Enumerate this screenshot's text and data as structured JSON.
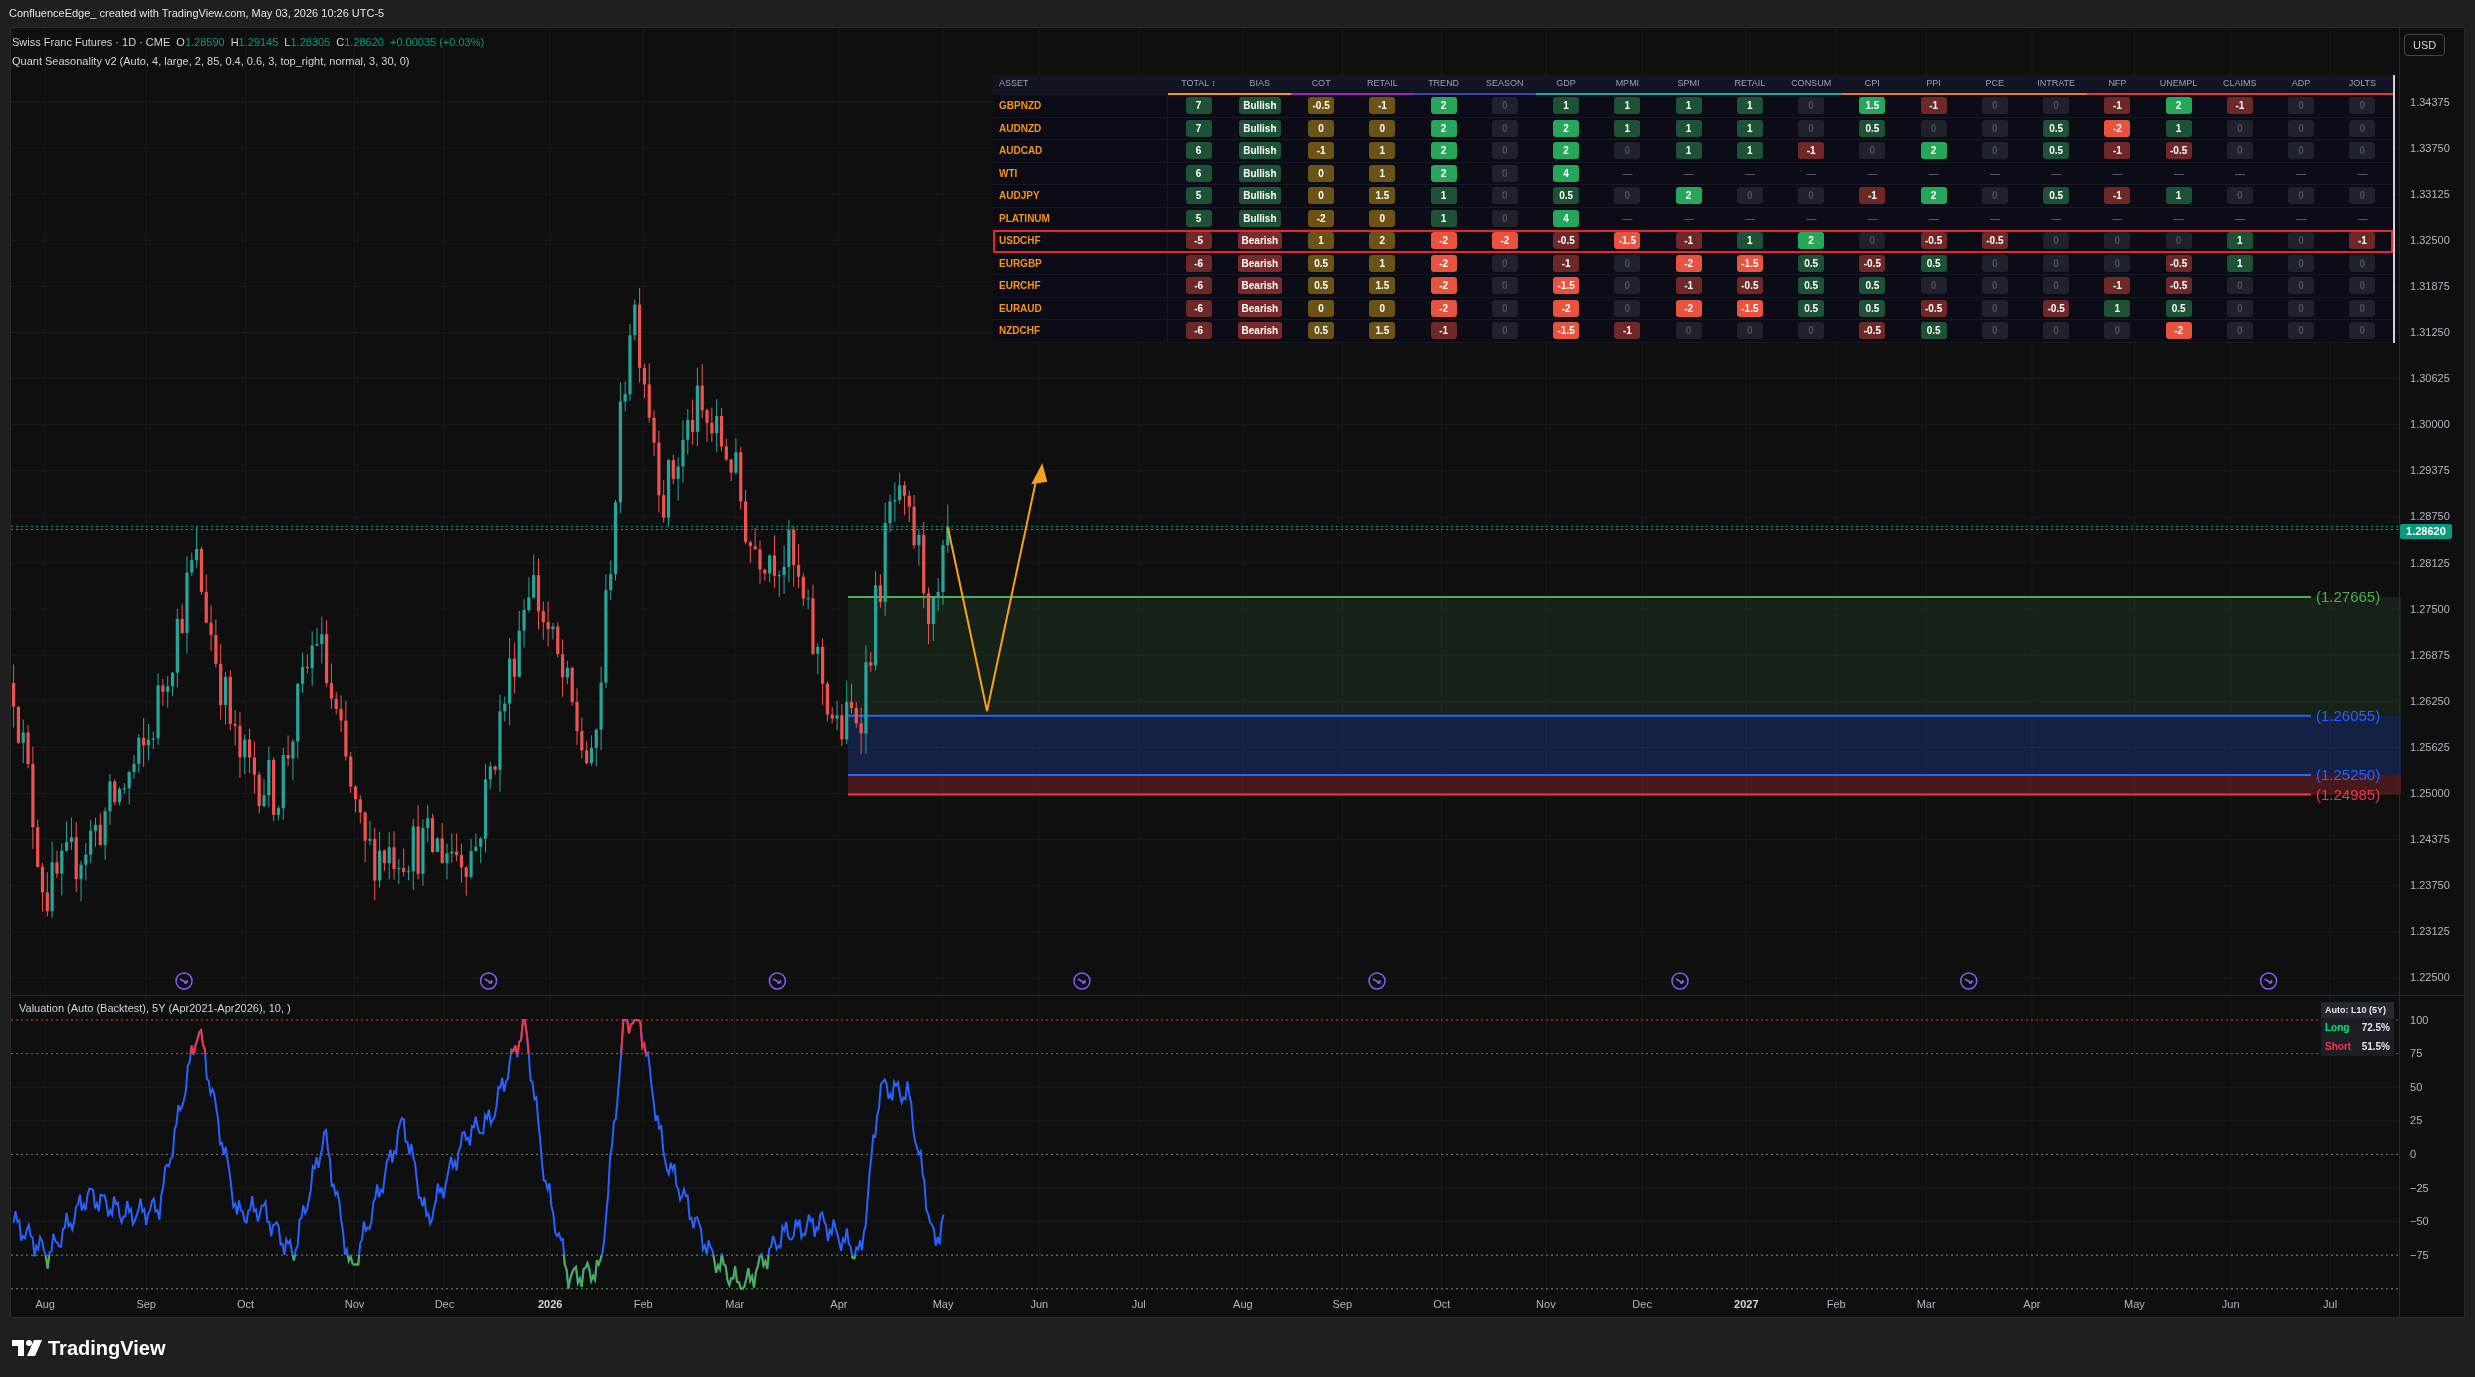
{
  "page_title": "ConfluenceEdge_ created with TradingView.com, May 03, 2026 10:26 UTC-5",
  "legend": {
    "symbol": "Swiss Franc Futures · 1D · CME",
    "ohlc": [
      {
        "label": "O",
        "value": "1.28590"
      },
      {
        "label": "H",
        "value": "1.29145"
      },
      {
        "label": "L",
        "value": "1.28305"
      },
      {
        "label": "C",
        "value": "1.28620"
      }
    ],
    "change": "+0.00035 (+0.03%)",
    "indicator": "Quant Seasonality v2 (Auto, 4, large, 2, 85, 0.4, 0.6, 3, top_right, normal, 3, 30, 0)"
  },
  "currency_button": "USD",
  "table": {
    "columns": [
      {
        "label": "ASSET"
      },
      {
        "label": "TOTAL ↕",
        "color": "#f59e0b"
      },
      {
        "label": "BIAS",
        "color": "#f59e0b"
      },
      {
        "label": "COT",
        "color": "#9c27b0"
      },
      {
        "label": "RETAIL",
        "color": "#9c27b0"
      },
      {
        "label": "TREND",
        "color": "#3949ab"
      },
      {
        "label": "SEASON",
        "color": "#3949ab"
      },
      {
        "label": "GDP",
        "color": "#26a69a"
      },
      {
        "label": "MPMI",
        "color": "#26a69a"
      },
      {
        "label": "SPMI",
        "color": "#26a69a"
      },
      {
        "label": "RETAIL",
        "color": "#26a69a"
      },
      {
        "label": "CONSUM",
        "color": "#26a69a"
      },
      {
        "label": "CPI",
        "color": "#e67e22"
      },
      {
        "label": "PPI",
        "color": "#e67e22"
      },
      {
        "label": "PCE",
        "color": "#e67e22"
      },
      {
        "label": "INTRATE",
        "color": "#e67e22"
      },
      {
        "label": "NFP",
        "color": "#e53935"
      },
      {
        "label": "UNEMPL",
        "color": "#e53935"
      },
      {
        "label": "CLAIMS",
        "color": "#e53935"
      },
      {
        "label": "ADP",
        "color": "#e53935"
      },
      {
        "label": "JOLTS",
        "color": "#e53935"
      }
    ],
    "rows": [
      {
        "selected": false,
        "cells": [
          {
            "text": "GBPNZD"
          },
          {
            "text": "7",
            "color": "#1d5236"
          },
          {
            "text": "Bullish",
            "color": "#1d5236"
          },
          {
            "text": "-0.5",
            "color": "#6b5316"
          },
          {
            "text": "-1",
            "color": "#6b5316"
          },
          {
            "text": "2",
            "color": "#26a65b"
          },
          {
            "text": "0",
            "color": "#1f212b"
          },
          {
            "text": "1",
            "color": "#1d5236"
          },
          {
            "text": "1",
            "color": "#1d5236"
          },
          {
            "text": "1",
            "color": "#1d5236"
          },
          {
            "text": "1",
            "color": "#1d5236"
          },
          {
            "text": "0",
            "color": "#1f212b"
          },
          {
            "text": "1.5",
            "color": "#26a65b"
          },
          {
            "text": "-1",
            "color": "#6e2828"
          },
          {
            "text": "0",
            "color": "#1f212b"
          },
          {
            "text": "0",
            "color": "#1f212b"
          },
          {
            "text": "-1",
            "color": "#6e2828"
          },
          {
            "text": "2",
            "color": "#26a65b"
          },
          {
            "text": "-1",
            "color": "#6e2828"
          },
          {
            "text": "0",
            "color": "#1f212b"
          },
          {
            "text": "0",
            "color": "#1f212b"
          }
        ]
      },
      {
        "selected": false,
        "cells": [
          {
            "text": "AUDNZD"
          },
          {
            "text": "7",
            "color": "#1d5236"
          },
          {
            "text": "Bullish",
            "color": "#1d5236"
          },
          {
            "text": "0",
            "color": "#6b5316"
          },
          {
            "text": "0",
            "color": "#6b5316"
          },
          {
            "text": "2",
            "color": "#26a65b"
          },
          {
            "text": "0",
            "color": "#1f212b"
          },
          {
            "text": "2",
            "color": "#26a65b"
          },
          {
            "text": "1",
            "color": "#1d5236"
          },
          {
            "text": "1",
            "color": "#1d5236"
          },
          {
            "text": "1",
            "color": "#1d5236"
          },
          {
            "text": "0",
            "color": "#1f212b"
          },
          {
            "text": "0.5",
            "color": "#1d5236"
          },
          {
            "text": "0",
            "color": "#1f212b"
          },
          {
            "text": "0",
            "color": "#1f212b"
          },
          {
            "text": "0.5",
            "color": "#1d5236"
          },
          {
            "text": "-2",
            "color": "#e8533f"
          },
          {
            "text": "1",
            "color": "#1d5236"
          },
          {
            "text": "0",
            "color": "#1f212b"
          },
          {
            "text": "0",
            "color": "#1f212b"
          },
          {
            "text": "0",
            "color": "#1f212b"
          }
        ]
      },
      {
        "selected": false,
        "cells": [
          {
            "text": "AUDCAD"
          },
          {
            "text": "6",
            "color": "#1d5236"
          },
          {
            "text": "Bullish",
            "color": "#1d5236"
          },
          {
            "text": "-1",
            "color": "#6b5316"
          },
          {
            "text": "1",
            "color": "#6b5316"
          },
          {
            "text": "2",
            "color": "#26a65b"
          },
          {
            "text": "0",
            "color": "#1f212b"
          },
          {
            "text": "2",
            "color": "#26a65b"
          },
          {
            "text": "0",
            "color": "#1f212b"
          },
          {
            "text": "1",
            "color": "#1d5236"
          },
          {
            "text": "1",
            "color": "#1d5236"
          },
          {
            "text": "-1",
            "color": "#6e2828"
          },
          {
            "text": "0",
            "color": "#1f212b"
          },
          {
            "text": "2",
            "color": "#26a65b"
          },
          {
            "text": "0",
            "color": "#1f212b"
          },
          {
            "text": "0.5",
            "color": "#1d5236"
          },
          {
            "text": "-1",
            "color": "#6e2828"
          },
          {
            "text": "-0.5",
            "color": "#6e2828"
          },
          {
            "text": "0",
            "color": "#1f212b"
          },
          {
            "text": "0",
            "color": "#1f212b"
          },
          {
            "text": "0",
            "color": "#1f212b"
          }
        ]
      },
      {
        "selected": false,
        "cells": [
          {
            "text": "WTI"
          },
          {
            "text": "6",
            "color": "#1d5236"
          },
          {
            "text": "Bullish",
            "color": "#1d5236"
          },
          {
            "text": "0",
            "color": "#6b5316"
          },
          {
            "text": "1",
            "color": "#6b5316"
          },
          {
            "text": "2",
            "color": "#26a65b"
          },
          {
            "text": "0",
            "color": "#1f212b"
          },
          {
            "text": "4",
            "color": "#26a65b"
          },
          {
            "text": "—"
          },
          {
            "text": "—"
          },
          {
            "text": "—"
          },
          {
            "text": "—"
          },
          {
            "text": "—"
          },
          {
            "text": "—"
          },
          {
            "text": "—"
          },
          {
            "text": "—"
          },
          {
            "text": "—"
          },
          {
            "text": "—"
          },
          {
            "text": "—"
          },
          {
            "text": "—"
          },
          {
            "text": "—"
          }
        ]
      },
      {
        "selected": false,
        "cells": [
          {
            "text": "AUDJPY"
          },
          {
            "text": "5",
            "color": "#1d5236"
          },
          {
            "text": "Bullish",
            "color": "#1d5236"
          },
          {
            "text": "0",
            "color": "#6b5316"
          },
          {
            "text": "1.5",
            "color": "#6b5316"
          },
          {
            "text": "1",
            "color": "#1d5236"
          },
          {
            "text": "0",
            "color": "#1f212b"
          },
          {
            "text": "0.5",
            "color": "#1d5236"
          },
          {
            "text": "0",
            "color": "#1f212b"
          },
          {
            "text": "2",
            "color": "#26a65b"
          },
          {
            "text": "0",
            "color": "#1f212b"
          },
          {
            "text": "0",
            "color": "#1f212b"
          },
          {
            "text": "-1",
            "color": "#6e2828"
          },
          {
            "text": "2",
            "color": "#26a65b"
          },
          {
            "text": "0",
            "color": "#1f212b"
          },
          {
            "text": "0.5",
            "color": "#1d5236"
          },
          {
            "text": "-1",
            "color": "#6e2828"
          },
          {
            "text": "1",
            "color": "#1d5236"
          },
          {
            "text": "0",
            "color": "#1f212b"
          },
          {
            "text": "0",
            "color": "#1f212b"
          },
          {
            "text": "0",
            "color": "#1f212b"
          }
        ]
      },
      {
        "selected": false,
        "cells": [
          {
            "text": "PLATINUM"
          },
          {
            "text": "5",
            "color": "#1d5236"
          },
          {
            "text": "Bullish",
            "color": "#1d5236"
          },
          {
            "text": "-2",
            "color": "#6b5316"
          },
          {
            "text": "0",
            "color": "#6b5316"
          },
          {
            "text": "1",
            "color": "#1d5236"
          },
          {
            "text": "0",
            "color": "#1f212b"
          },
          {
            "text": "4",
            "color": "#26a65b"
          },
          {
            "text": "—"
          },
          {
            "text": "—"
          },
          {
            "text": "—"
          },
          {
            "text": "—"
          },
          {
            "text": "—"
          },
          {
            "text": "—"
          },
          {
            "text": "—"
          },
          {
            "text": "—"
          },
          {
            "text": "—"
          },
          {
            "text": "—"
          },
          {
            "text": "—"
          },
          {
            "text": "—"
          },
          {
            "text": "—"
          }
        ]
      },
      {
        "selected": true,
        "cells": [
          {
            "text": "USDCHF"
          },
          {
            "text": "-5",
            "color": "#6e2828"
          },
          {
            "text": "Bearish",
            "color": "#7a2a2a"
          },
          {
            "text": "1",
            "color": "#6b5316"
          },
          {
            "text": "2",
            "color": "#6b5316"
          },
          {
            "text": "-2",
            "color": "#e8533f"
          },
          {
            "text": "-2",
            "color": "#e8533f"
          },
          {
            "text": "-0.5",
            "color": "#6e2828"
          },
          {
            "text": "-1.5",
            "color": "#e8533f"
          },
          {
            "text": "-1",
            "color": "#6e2828"
          },
          {
            "text": "1",
            "color": "#1d5236"
          },
          {
            "text": "2",
            "color": "#26a65b"
          },
          {
            "text": "0",
            "color": "#1f212b"
          },
          {
            "text": "-0.5",
            "color": "#6e2828"
          },
          {
            "text": "-0.5",
            "color": "#6e2828"
          },
          {
            "text": "0",
            "color": "#1f212b"
          },
          {
            "text": "0",
            "color": "#1f212b"
          },
          {
            "text": "0",
            "color": "#1f212b"
          },
          {
            "text": "1",
            "color": "#1d5236"
          },
          {
            "text": "0",
            "color": "#1f212b"
          },
          {
            "text": "-1",
            "color": "#6e2828"
          }
        ]
      },
      {
        "selected": false,
        "cells": [
          {
            "text": "EURGBP"
          },
          {
            "text": "-6",
            "color": "#6e2828"
          },
          {
            "text": "Bearish",
            "color": "#7a2a2a"
          },
          {
            "text": "0.5",
            "color": "#6b5316"
          },
          {
            "text": "1",
            "color": "#6b5316"
          },
          {
            "text": "-2",
            "color": "#e8533f"
          },
          {
            "text": "0",
            "color": "#1f212b"
          },
          {
            "text": "-1",
            "color": "#6e2828"
          },
          {
            "text": "0",
            "color": "#1f212b"
          },
          {
            "text": "-2",
            "color": "#e8533f"
          },
          {
            "text": "-1.5",
            "color": "#e8533f"
          },
          {
            "text": "0.5",
            "color": "#1d5236"
          },
          {
            "text": "-0.5",
            "color": "#6e2828"
          },
          {
            "text": "0.5",
            "color": "#1d5236"
          },
          {
            "text": "0",
            "color": "#1f212b"
          },
          {
            "text": "0",
            "color": "#1f212b"
          },
          {
            "text": "0",
            "color": "#1f212b"
          },
          {
            "text": "-0.5",
            "color": "#6e2828"
          },
          {
            "text": "1",
            "color": "#1d5236"
          },
          {
            "text": "0",
            "color": "#1f212b"
          },
          {
            "text": "0",
            "color": "#1f212b"
          }
        ]
      },
      {
        "selected": false,
        "cells": [
          {
            "text": "EURCHF"
          },
          {
            "text": "-6",
            "color": "#6e2828"
          },
          {
            "text": "Bearish",
            "color": "#7a2a2a"
          },
          {
            "text": "0.5",
            "color": "#6b5316"
          },
          {
            "text": "1.5",
            "color": "#6b5316"
          },
          {
            "text": "-2",
            "color": "#e8533f"
          },
          {
            "text": "0",
            "color": "#1f212b"
          },
          {
            "text": "-1.5",
            "color": "#e8533f"
          },
          {
            "text": "0",
            "color": "#1f212b"
          },
          {
            "text": "-1",
            "color": "#6e2828"
          },
          {
            "text": "-0.5",
            "color": "#6e2828"
          },
          {
            "text": "0.5",
            "color": "#1d5236"
          },
          {
            "text": "0.5",
            "color": "#1d5236"
          },
          {
            "text": "0",
            "color": "#1f212b"
          },
          {
            "text": "0",
            "color": "#1f212b"
          },
          {
            "text": "0",
            "color": "#1f212b"
          },
          {
            "text": "-1",
            "color": "#6e2828"
          },
          {
            "text": "-0.5",
            "color": "#6e2828"
          },
          {
            "text": "0",
            "color": "#1f212b"
          },
          {
            "text": "0",
            "color": "#1f212b"
          },
          {
            "text": "0",
            "color": "#1f212b"
          }
        ]
      },
      {
        "selected": false,
        "cells": [
          {
            "text": "EURAUD"
          },
          {
            "text": "-6",
            "color": "#6e2828"
          },
          {
            "text": "Bearish",
            "color": "#7a2a2a"
          },
          {
            "text": "0",
            "color": "#6b5316"
          },
          {
            "text": "0",
            "color": "#6b5316"
          },
          {
            "text": "-2",
            "color": "#e8533f"
          },
          {
            "text": "0",
            "color": "#1f212b"
          },
          {
            "text": "-2",
            "color": "#e8533f"
          },
          {
            "text": "0",
            "color": "#1f212b"
          },
          {
            "text": "-2",
            "color": "#e8533f"
          },
          {
            "text": "-1.5",
            "color": "#e8533f"
          },
          {
            "text": "0.5",
            "color": "#1d5236"
          },
          {
            "text": "0.5",
            "color": "#1d5236"
          },
          {
            "text": "-0.5",
            "color": "#6e2828"
          },
          {
            "text": "0",
            "color": "#1f212b"
          },
          {
            "text": "-0.5",
            "color": "#6e2828"
          },
          {
            "text": "1",
            "color": "#1d5236"
          },
          {
            "text": "0.5",
            "color": "#1d5236"
          },
          {
            "text": "0",
            "color": "#1f212b"
          },
          {
            "text": "0",
            "color": "#1f212b"
          },
          {
            "text": "0",
            "color": "#1f212b"
          }
        ]
      },
      {
        "selected": false,
        "cells": [
          {
            "text": "NZDCHF"
          },
          {
            "text": "-6",
            "color": "#6e2828"
          },
          {
            "text": "Bearish",
            "color": "#7a2a2a"
          },
          {
            "text": "0.5",
            "color": "#6b5316"
          },
          {
            "text": "1.5",
            "color": "#6b5316"
          },
          {
            "text": "-1",
            "color": "#6e2828"
          },
          {
            "text": "0",
            "color": "#1f212b"
          },
          {
            "text": "-1.5",
            "color": "#e8533f"
          },
          {
            "text": "-1",
            "color": "#6e2828"
          },
          {
            "text": "0",
            "color": "#1f212b"
          },
          {
            "text": "0",
            "color": "#1f212b"
          },
          {
            "text": "0",
            "color": "#1f212b"
          },
          {
            "text": "-0.5",
            "color": "#6e2828"
          },
          {
            "text": "0.5",
            "color": "#1d5236"
          },
          {
            "text": "0",
            "color": "#1f212b"
          },
          {
            "text": "0",
            "color": "#1f212b"
          },
          {
            "text": "0",
            "color": "#1f212b"
          },
          {
            "text": "-2",
            "color": "#e8533f"
          },
          {
            "text": "0",
            "color": "#1f212b"
          },
          {
            "text": "0",
            "color": "#1f212b"
          },
          {
            "text": "0",
            "color": "#1f212b"
          }
        ]
      }
    ]
  },
  "levels": [
    {
      "label": "(1.27665)",
      "color": "#4caf50"
    },
    {
      "label": "(1.26055)",
      "color": "#2962ff"
    },
    {
      "label": "(1.25250)",
      "color": "#2962ff"
    },
    {
      "label": "(1.24985)",
      "color": "#f23645"
    }
  ],
  "last_price": "1.28620",
  "price_axis": [
    "1.34375",
    "1.33750",
    "1.33125",
    "1.32500",
    "1.31875",
    "1.31250",
    "1.30625",
    "1.30000",
    "1.29375",
    "1.28750",
    "1.28125",
    "1.27500",
    "1.26875",
    "1.26250",
    "1.25625",
    "1.25000",
    "1.24375",
    "1.23750",
    "1.23125",
    "1.22500"
  ],
  "time_axis": [
    {
      "text": "Aug",
      "kind": "month"
    },
    {
      "text": "Sep",
      "kind": "month"
    },
    {
      "text": "Oct",
      "kind": "month"
    },
    {
      "text": "Nov",
      "kind": "month"
    },
    {
      "text": "Dec",
      "kind": "month"
    },
    {
      "text": "2026",
      "kind": "year"
    },
    {
      "text": "Feb",
      "kind": "month"
    },
    {
      "text": "Mar",
      "kind": "month"
    },
    {
      "text": "Apr",
      "kind": "month"
    },
    {
      "text": "May",
      "kind": "month"
    },
    {
      "text": "Jun",
      "kind": "month"
    },
    {
      "text": "Jul",
      "kind": "month"
    },
    {
      "text": "Aug",
      "kind": "month"
    },
    {
      "text": "Sep",
      "kind": "month"
    },
    {
      "text": "Oct",
      "kind": "month"
    },
    {
      "text": "Nov",
      "kind": "month"
    },
    {
      "text": "Dec",
      "kind": "month"
    },
    {
      "text": "2027",
      "kind": "year"
    },
    {
      "text": "Feb",
      "kind": "month"
    },
    {
      "text": "Mar",
      "kind": "month"
    },
    {
      "text": "Apr",
      "kind": "month"
    },
    {
      "text": "May",
      "kind": "month"
    },
    {
      "text": "Jun",
      "kind": "month"
    },
    {
      "text": "Jul",
      "kind": "month"
    }
  ],
  "lower_pane": {
    "title": "Valuation (Auto (Backtest), 5Y (Apr2021-Apr2026), 10, )",
    "axis": [
      "100",
      "75",
      "50",
      "25",
      "0",
      "−25",
      "−50",
      "−75"
    ],
    "legend": {
      "title": "Auto: L10 (5Y)",
      "rows": [
        {
          "label": "Long",
          "value": "72.5%",
          "color": "#00e676"
        },
        {
          "label": "Short",
          "value": "51.5%",
          "color": "#f23645"
        }
      ]
    }
  },
  "footer": {
    "brand": "TradingView"
  }
}
